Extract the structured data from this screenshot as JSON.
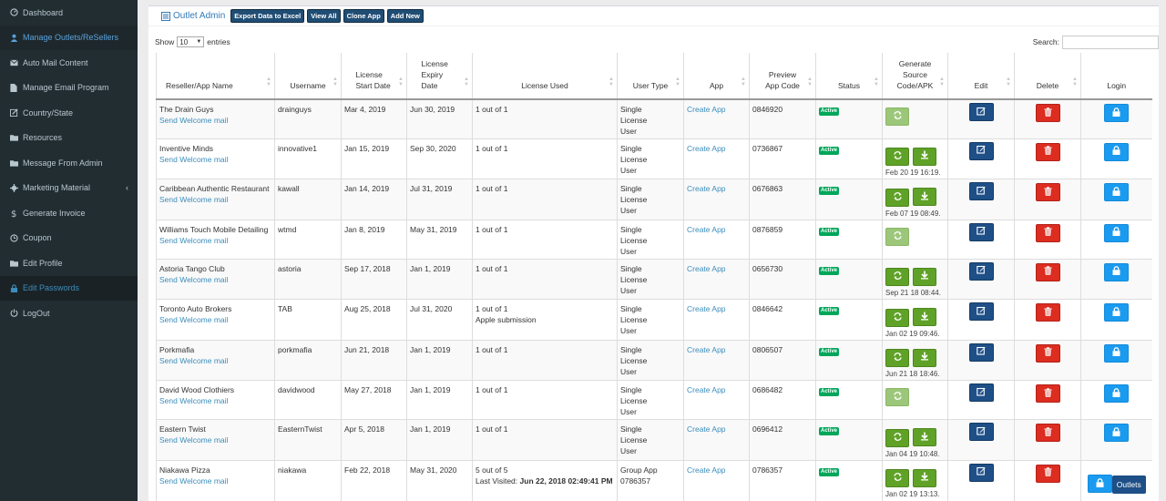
{
  "sidebar": {
    "items": [
      {
        "label": "Dashboard",
        "icon": "dashboard-icon"
      },
      {
        "label": "Manage Outlets/ReSellers",
        "icon": "user-icon"
      },
      {
        "label": "Auto Mail Content",
        "icon": "envelope-icon"
      },
      {
        "label": "Manage Email Program",
        "icon": "file-icon"
      },
      {
        "label": "Country/State",
        "icon": "edit-icon"
      },
      {
        "label": "Resources",
        "icon": "folder-icon"
      },
      {
        "label": "Message From Admin",
        "icon": "folder-icon"
      },
      {
        "label": "Marketing Material",
        "icon": "gear-icon"
      },
      {
        "label": "Generate Invoice",
        "icon": "dollar-icon"
      },
      {
        "label": "Coupon",
        "icon": "clock-icon"
      },
      {
        "label": "Edit Profile",
        "icon": "folder-icon"
      },
      {
        "label": "Edit Passwords",
        "icon": "lock-icon"
      },
      {
        "label": "LogOut",
        "icon": "power-icon"
      }
    ]
  },
  "header": {
    "title": "Outlet Admin",
    "buttons": [
      "Export Data to Excel",
      "View All",
      "Clone App",
      "Add New"
    ]
  },
  "controls": {
    "show_label": "Show",
    "show_value": "10",
    "entries_label": "entries",
    "search_label": "Search:"
  },
  "table": {
    "columns": [
      "Reseller/App Name",
      "Username",
      "License Start Date",
      "License Expiry Date",
      "License Used",
      "User Type",
      "App",
      "Preview App Code",
      "Status",
      "Generate Source Code/APK",
      "Edit",
      "Delete",
      "Login"
    ],
    "welcome_link": "Send Welcome mail",
    "app_link": "Create App",
    "status_text": "Active",
    "outlets_button": "Outlets",
    "rows": [
      {
        "name": "The Drain Guys",
        "username": "drainguys",
        "start": "Mar 4, 2019",
        "expiry": "Jun 30, 2019",
        "license": "1 out of 1",
        "license_extra": "",
        "user_type": "Single License User",
        "code": "0846920",
        "download": false,
        "gen_ts": ""
      },
      {
        "name": "Inventive Minds",
        "username": "innovative1",
        "start": "Jan 15, 2019",
        "expiry": "Sep 30, 2020",
        "license": "1 out of 1",
        "license_extra": "",
        "user_type": "Single License User",
        "code": "0736867",
        "download": true,
        "gen_ts": "Feb 20 19 16:19."
      },
      {
        "name": "Caribbean Authentic Restaurant",
        "username": "kawall",
        "start": "Jan 14, 2019",
        "expiry": "Jul 31, 2019",
        "license": "1 out of 1",
        "license_extra": "",
        "user_type": "Single License User",
        "code": "0676863",
        "download": true,
        "gen_ts": "Feb 07 19 08:49."
      },
      {
        "name": "Williams Touch Mobile Detailing",
        "username": "wtmd",
        "start": "Jan 8, 2019",
        "expiry": "May 31, 2019",
        "license": "1 out of 1",
        "license_extra": "",
        "user_type": "Single License User",
        "code": "0876859",
        "download": false,
        "gen_ts": ""
      },
      {
        "name": "Astoria Tango Club",
        "username": "astoria",
        "start": "Sep 17, 2018",
        "expiry": "Jan 1, 2019",
        "license": "1 out of 1",
        "license_extra": "",
        "user_type": "Single License User",
        "code": "0656730",
        "download": true,
        "gen_ts": "Sep 21 18 08:44."
      },
      {
        "name": "Toronto Auto Brokers",
        "username": "TAB",
        "start": "Aug 25, 2018",
        "expiry": "Jul 31, 2020",
        "license": "1 out of 1",
        "license_extra": "Apple submission",
        "user_type": "Single License User",
        "code": "0846642",
        "download": true,
        "gen_ts": "Jan 02 19 09:46."
      },
      {
        "name": "Porkmafia",
        "username": "porkmafia",
        "start": "Jun 21, 2018",
        "expiry": "Jan 1, 2019",
        "license": "1 out of 1",
        "license_extra": "",
        "user_type": "Single License User",
        "code": "0806507",
        "download": true,
        "gen_ts": "Jun 21 18 18:46."
      },
      {
        "name": "David Wood Clothiers",
        "username": "davidwood",
        "start": "May 27, 2018",
        "expiry": "Jan 1, 2019",
        "license": "1 out of 1",
        "license_extra": "",
        "user_type": "Single License User",
        "code": "0686482",
        "download": false,
        "gen_ts": ""
      },
      {
        "name": "Eastern Twist",
        "username": "EasternTwist",
        "start": "Apr 5, 2018",
        "expiry": "Jan 1, 2019",
        "license": "1 out of 1",
        "license_extra": "",
        "user_type": "Single License User",
        "code": "0696412",
        "download": true,
        "gen_ts": "Jan 04 19 10:48."
      },
      {
        "name": "Niakawa Pizza",
        "username": "niakawa",
        "start": "Feb 22, 2018",
        "expiry": "May 31, 2020",
        "license": "5 out of 5",
        "license_extra": "",
        "last_visited_label": "Last Visited:",
        "last_visited": "Jun 22, 2018 02:49:41 PM",
        "user_type": "Group App",
        "group_code": "0786357",
        "code": "0786357",
        "download": true,
        "gen_ts": "Jan 02 19 13:13.",
        "outlets": true
      }
    ]
  },
  "colors": {
    "sidebar_bg": "#222d32",
    "link": "#3c8dbc",
    "status_green": "#00a65a",
    "gen_green": "#5fa227",
    "edit_blue": "#1e4f86",
    "delete_red": "#dd2c20",
    "login_blue": "#1a9bf0"
  }
}
